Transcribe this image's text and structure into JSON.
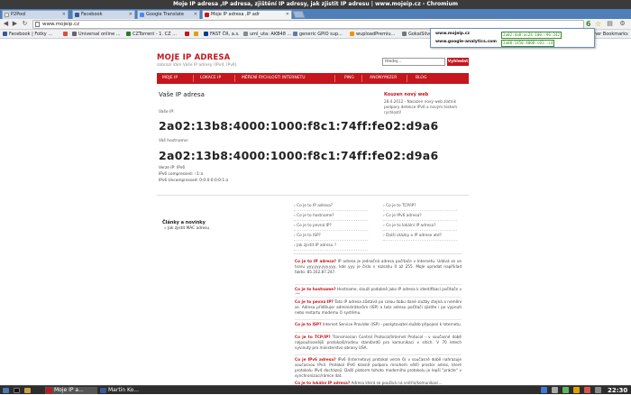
{
  "window": {
    "title": "Moje IP adresa ,IP adresa, zjištění IP adresy, jak zjistit IP adresu | www.mojeip.cz - Chromium"
  },
  "tabs": [
    {
      "label": "P2Pool",
      "color": "#e8e8e8"
    },
    {
      "label": "Facebook",
      "color": "#3b5998"
    },
    {
      "label": "Google Translate",
      "color": "#4a8af4"
    },
    {
      "label": "Moje IP adresa ,IP adr",
      "color": "#c4161c"
    }
  ],
  "toolbar": {
    "url": "www.mojeip.cz",
    "ext_badge": "6"
  },
  "bookmarks": [
    {
      "label": "Facebook | Fotky ...",
      "color": "#3b5998"
    },
    {
      "label": "",
      "color": "#dd4b39"
    },
    {
      "label": "Universal online ...",
      "color": "#666666"
    },
    {
      "label": "CZTorrent - 1. CZ ...",
      "color": "#2d7a2d"
    },
    {
      "label": "",
      "color": "#c4161c"
    },
    {
      "label": "",
      "color": "#e0a000"
    },
    {
      "label": "FAST ČR, a.s.",
      "color": "#003c8f"
    },
    {
      "label": "uml_uta: AKB48 ...",
      "color": "#888888"
    },
    {
      "label": "generic GPIO sup...",
      "color": "#5a7fa8"
    },
    {
      "label": "wuploadPremiu...",
      "color": "#f29400"
    },
    {
      "label": "GokaiSilve...",
      "color": "#777777"
    },
    {
      "label": "Other Bookmarks",
      "color": "#d9b24c"
    }
  ],
  "popup": {
    "rows": [
      {
        "domain": "www.mojeip.cz",
        "ip": "2a02:4a8:ac24:100::96:242"
      },
      {
        "domain": "www.google-analytics.com",
        "ip": "2a00:1450:4008:c01::c4"
      }
    ]
  },
  "site": {
    "logo": "MOJE IP ADRESA",
    "tagline": "zobrazí Vám Vaše IP adresy (IPv4, IPv6)",
    "search_value": "Hledej...",
    "search_button": "Vyhledat",
    "nav": [
      "MOJE IP",
      "LOKACE IP",
      "MĚŘENÍ RYCHLOSTI INTERNETU",
      "PING",
      "ANONYMIZER",
      "BLOG"
    ],
    "heading": "Vaše IP adresa",
    "ip_label": "Vaše IP:",
    "ip": "2a02:13b8:4000:1000:f8c1:74ff:fe02:d9a6",
    "host_label": "Váš hostname:",
    "hostname": "2a02:13b8:4000:1000:f8c1:74ff:fe02:d9a6",
    "version": "Verze IP: IPv6",
    "compressed": "IPv6 compressed: ::1:a",
    "uncompressed": "IPv6 Uncompressed: 0:0:0:0:0:0:1:a",
    "news": {
      "title": "Kouzen nový web",
      "text": "28.4.2012 - Nasazen nový web zlatnik podpory detekce IPv6 a novým testem rychlosti!"
    },
    "links_left": [
      "Co je to IP adresa?",
      "Co je to hostname?",
      "Co je to pevná IP?",
      "Co je to ISP?",
      "Jak zjistit IP adresu ?"
    ],
    "links_right": [
      "Co je to TCP/IP?",
      "Co je IPv6 adresa?",
      "Co je to lokální IP adresa?",
      "Další otázky o IP adrese atd?"
    ],
    "articles_title": "Články a novinky",
    "articles": [
      "Jak zjistit MAC adresu"
    ],
    "faq": [
      {
        "q": "Co je to IP adresa?",
        "a": " IP adresa je jednačná adresa počítače v Internetu. Udává se ve tvaru yyy.yyy.yyy.yyy, kde yyy je číslo v rozsahu 0 až 255. MoJe uprodat například takto: 85.162.87.247."
      },
      {
        "q": "Co je to hostname?",
        "a": " Hostname, slouží podobně jako IP adresa k identifikaci počítače v síti."
      },
      {
        "q": "Co je to pevná IP?",
        "a": " Tato IP adresa zůstává po celou dobu dané služby stejná a nemění se. Adresa přidělujer administrátorům (ISP) a tuto adresu počítači zjistíte i po vypnutí nebo restartu modemu či systému."
      },
      {
        "q": "Co je to ISP?",
        "a": " Internet Service Provider (ISP) - poskytovatel služeb připojení k Internetu."
      },
      {
        "q": "Co je to TCP/IP?",
        "a": " Transmission Control Protocol/Internet Protocol - v současné době nejpoužívanější protokolů/rodinu standardů pro komunikaci v sítích. V 70 letech vyvinutý pro ministerstvo obrany USA."
      },
      {
        "q": "Co je IPv6 adresa?",
        "a": " IPv6 (Internetový protokol verze 6) v současné době nahrazuje současnou IPv4. Protokol IPv6 klasně podporu mnohem větší prostor adres, které protokolu IPv4 docházejí. Další platorm tohoto moderního protokolu je lepší \"prácte\" v synchronizaci/rámce dat."
      },
      {
        "q": "Co je to lokální IP adresa?",
        "a": " Adresa která se používá na vnitřní/komunikaci..."
      }
    ]
  },
  "taskbar": {
    "apps": [
      {
        "label": "Moje IP a...",
        "color": "#c4161c"
      },
      {
        "label": "Martin Ko...",
        "color": "#3b5998"
      }
    ],
    "clock": "22:30"
  }
}
